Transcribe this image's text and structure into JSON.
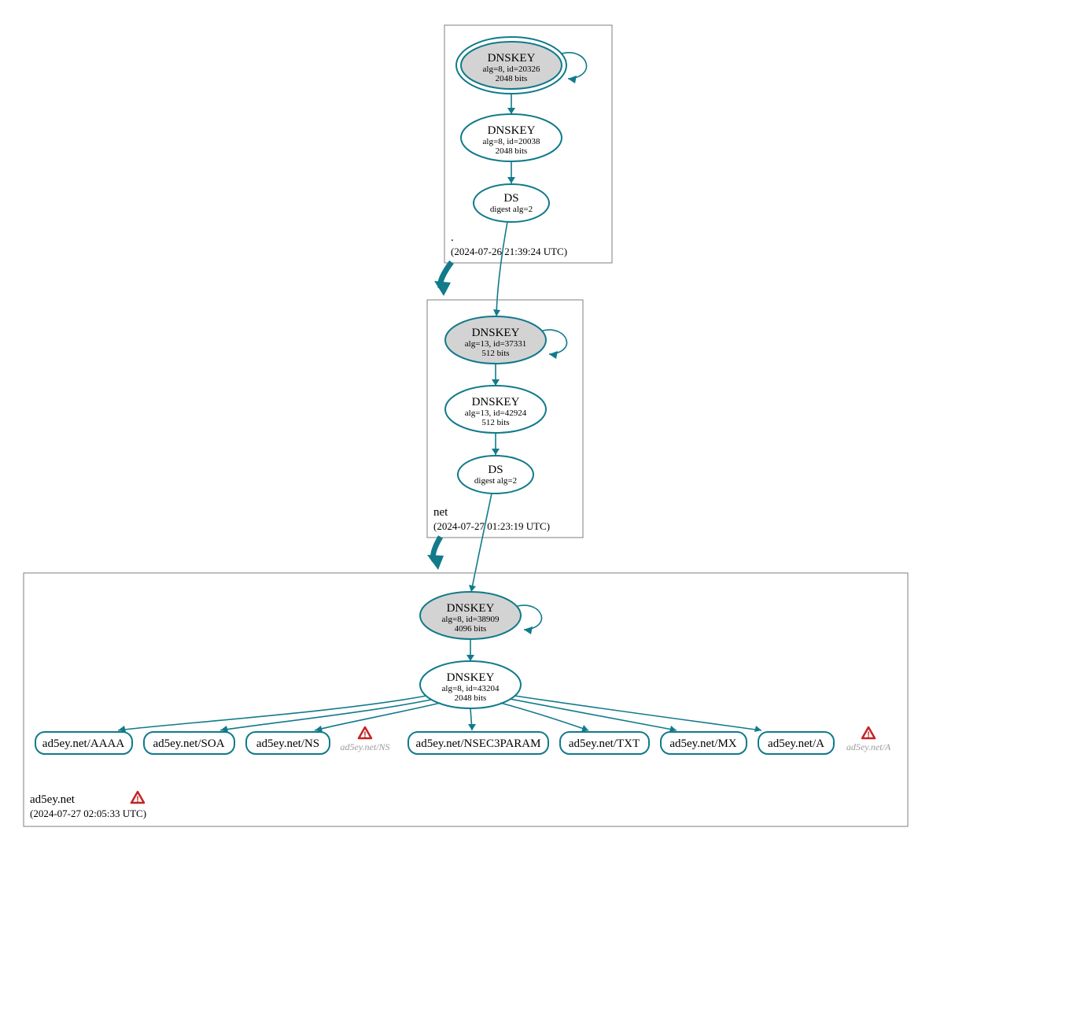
{
  "colors": {
    "stroke": "#117a8b",
    "ksk_fill": "#d3d3d3",
    "box_stroke": "#7f7f7f",
    "warning": "#c62222"
  },
  "zones": [
    {
      "id": "root",
      "label": ".",
      "timestamp": "(2024-07-26 21:39:24 UTC)",
      "has_warning": false,
      "nodes": [
        {
          "id": "root_ksk",
          "type": "ellipse-ksk-double",
          "title": "DNSKEY",
          "line2": "alg=8, id=20326",
          "line3": "2048 bits",
          "self_loop": true
        },
        {
          "id": "root_zsk",
          "type": "ellipse",
          "title": "DNSKEY",
          "line2": "alg=8, id=20038",
          "line3": "2048 bits"
        },
        {
          "id": "root_ds",
          "type": "ellipse",
          "title": "DS",
          "line2": "digest alg=2"
        }
      ]
    },
    {
      "id": "net",
      "label": "net",
      "timestamp": "(2024-07-27 01:23:19 UTC)",
      "has_warning": false,
      "nodes": [
        {
          "id": "net_ksk",
          "type": "ellipse-ksk",
          "title": "DNSKEY",
          "line2": "alg=13, id=37331",
          "line3": "512 bits",
          "self_loop": true
        },
        {
          "id": "net_zsk",
          "type": "ellipse",
          "title": "DNSKEY",
          "line2": "alg=13, id=42924",
          "line3": "512 bits"
        },
        {
          "id": "net_ds",
          "type": "ellipse",
          "title": "DS",
          "line2": "digest alg=2"
        }
      ]
    },
    {
      "id": "ad5ey",
      "label": "ad5ey.net",
      "timestamp": "(2024-07-27 02:05:33 UTC)",
      "has_warning": true,
      "nodes": [
        {
          "id": "ad5ey_ksk",
          "type": "ellipse-ksk",
          "title": "DNSKEY",
          "line2": "alg=8, id=38909",
          "line3": "4096 bits",
          "self_loop": true
        },
        {
          "id": "ad5ey_zsk",
          "type": "ellipse",
          "title": "DNSKEY",
          "line2": "alg=8, id=43204",
          "line3": "2048 bits"
        }
      ],
      "rrsets": [
        {
          "id": "rr_aaaa",
          "label": "ad5ey.net/AAAA"
        },
        {
          "id": "rr_soa",
          "label": "ad5ey.net/SOA"
        },
        {
          "id": "rr_ns",
          "label": "ad5ey.net/NS"
        },
        {
          "id": "rr_nsec3",
          "label": "ad5ey.net/NSEC3PARAM"
        },
        {
          "id": "rr_txt",
          "label": "ad5ey.net/TXT"
        },
        {
          "id": "rr_mx",
          "label": "ad5ey.net/MX"
        },
        {
          "id": "rr_a",
          "label": "ad5ey.net/A"
        }
      ],
      "warning_nodes": [
        {
          "id": "warn_ns",
          "label": "ad5ey.net/NS"
        },
        {
          "id": "warn_a",
          "label": "ad5ey.net/A"
        }
      ]
    }
  ],
  "edges": [
    {
      "from": "root_ksk",
      "to": "root_zsk"
    },
    {
      "from": "root_zsk",
      "to": "root_ds"
    },
    {
      "from": "root_ds",
      "to": "net_ksk"
    },
    {
      "from": "net_ksk",
      "to": "net_zsk"
    },
    {
      "from": "net_zsk",
      "to": "net_ds"
    },
    {
      "from": "net_ds",
      "to": "ad5ey_ksk"
    },
    {
      "from": "ad5ey_ksk",
      "to": "ad5ey_zsk"
    },
    {
      "from": "ad5ey_zsk",
      "to": "rr_aaaa"
    },
    {
      "from": "ad5ey_zsk",
      "to": "rr_soa"
    },
    {
      "from": "ad5ey_zsk",
      "to": "rr_ns"
    },
    {
      "from": "ad5ey_zsk",
      "to": "rr_nsec3"
    },
    {
      "from": "ad5ey_zsk",
      "to": "rr_txt"
    },
    {
      "from": "ad5ey_zsk",
      "to": "rr_mx"
    },
    {
      "from": "ad5ey_zsk",
      "to": "rr_a"
    }
  ],
  "delegation_edges": [
    {
      "from_zone": "root",
      "to_zone": "net"
    },
    {
      "from_zone": "net",
      "to_zone": "ad5ey"
    }
  ]
}
